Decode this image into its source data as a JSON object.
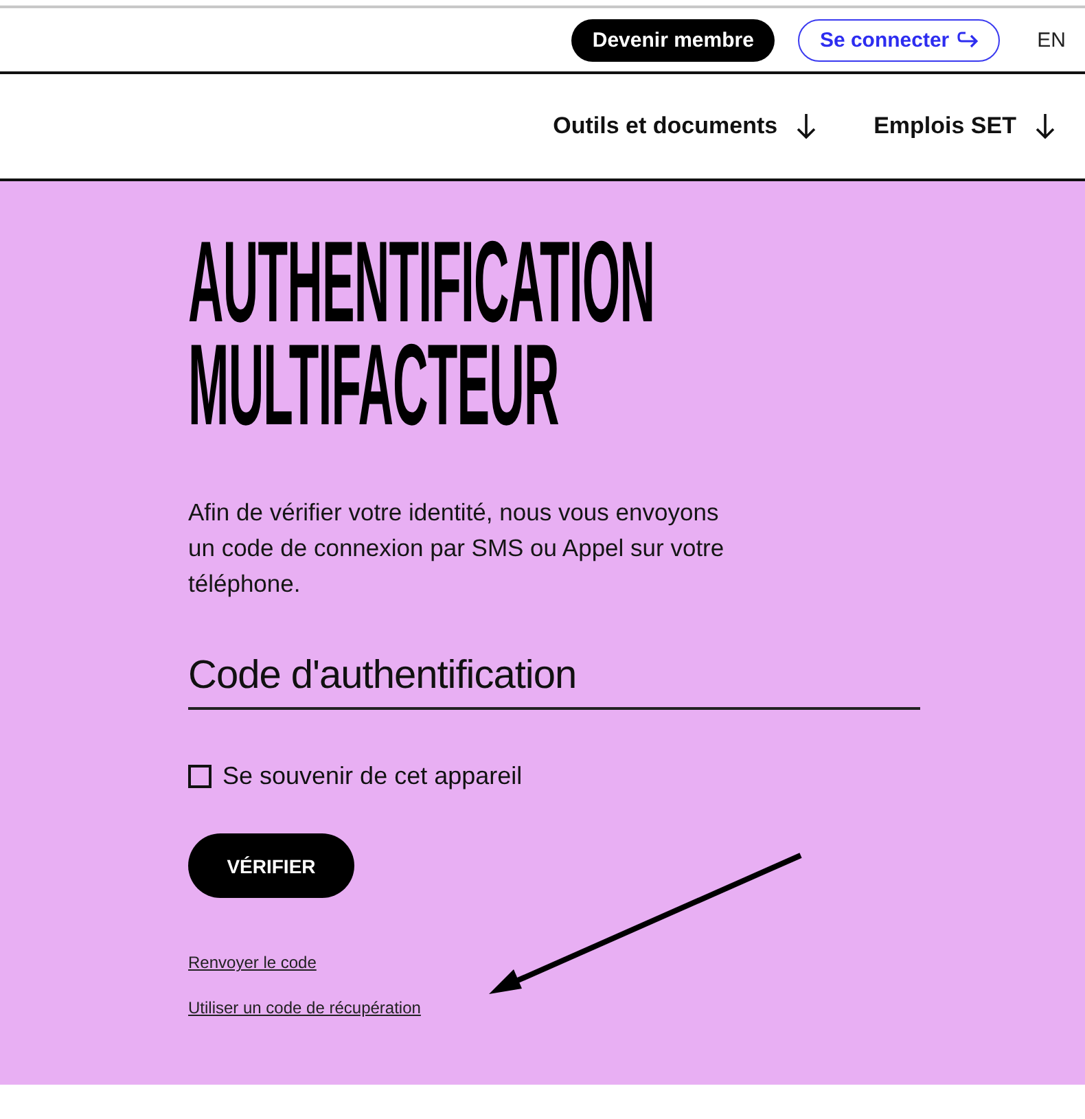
{
  "header": {
    "join_button": "Devenir membre",
    "login_button": "Se connecter",
    "language": "EN"
  },
  "nav": {
    "items": [
      {
        "label": "Outils et documents"
      },
      {
        "label": "Emplois SET"
      }
    ]
  },
  "form": {
    "title": "AUTHENTIFICATION MULTIFACTEUR",
    "description": "Afin de vérifier votre identité, nous vous envoyons un code de connexion par SMS ou Appel sur votre téléphone.",
    "code_field": {
      "placeholder": "Code d'authentification"
    },
    "remember": {
      "label": "Se souvenir de cet appareil",
      "checked": false
    },
    "submit_button": "VÉRIFIER",
    "links": [
      "Renvoyer le code",
      "Utiliser un code de récupération"
    ]
  }
}
